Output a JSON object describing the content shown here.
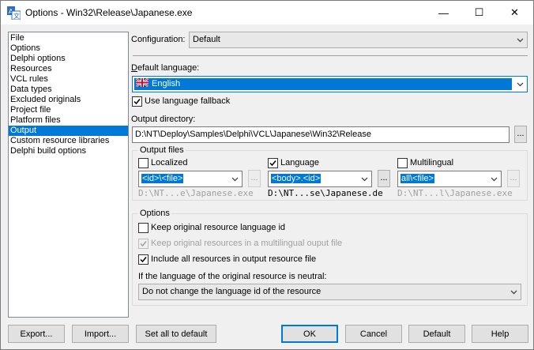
{
  "window": {
    "title": "Options - Win32\\Release\\Japanese.exe",
    "minimize_glyph": "—",
    "maximize_glyph": "☐",
    "close_glyph": "✕",
    "icon": "language-app-icon"
  },
  "tree": {
    "items": [
      {
        "label": "File",
        "selected": false
      },
      {
        "label": "Options",
        "selected": false
      },
      {
        "label": "Delphi options",
        "selected": false
      },
      {
        "label": "Resources",
        "selected": false
      },
      {
        "label": "VCL rules",
        "selected": false
      },
      {
        "label": "Data types",
        "selected": false
      },
      {
        "label": "Excluded originals",
        "selected": false
      },
      {
        "label": "Project file",
        "selected": false
      },
      {
        "label": "Platform files",
        "selected": false
      },
      {
        "label": "Output",
        "selected": true
      },
      {
        "label": "Custom resource libraries",
        "selected": false
      },
      {
        "label": "Delphi build options",
        "selected": false
      }
    ]
  },
  "configuration": {
    "label": "Configuration:",
    "value": "Default"
  },
  "default_language": {
    "label": "Default language:",
    "value": "English",
    "flag_icon": "uk-flag-icon"
  },
  "use_fallback": {
    "label": "Use language fallback",
    "checked": true
  },
  "output_directory": {
    "label": "Output directory:",
    "value": "D:\\NT\\Deploy\\Samples\\Delphi\\VCL\\Japanese\\Win32\\Release",
    "browse_label": "..."
  },
  "output_files": {
    "title": "Output files",
    "localized": {
      "label": "Localized",
      "checked": false,
      "pattern": "<id>\\<file>",
      "preview": "D:\\NT...e\\Japanese.exe",
      "browse_label": "..."
    },
    "language": {
      "label": "Language",
      "checked": true,
      "pattern": "<body>.<id>",
      "preview": "D:\\NT...se\\Japanese.de",
      "browse_label": "..."
    },
    "multilingual": {
      "label": "Multilingual",
      "checked": false,
      "pattern": "all\\<file>",
      "preview": "D:\\NT...l\\Japanese.exe",
      "browse_label": "..."
    }
  },
  "options": {
    "title": "Options",
    "keep_language_id": {
      "label": "Keep original resource language id",
      "checked": false
    },
    "keep_multilingual": {
      "label": "Keep original resources in a multilingual ouput file",
      "checked": true,
      "disabled": true
    },
    "include_all": {
      "label": "Include all resources in output resource file",
      "checked": true
    },
    "neutral_label": "If the language of the original resource is neutral:",
    "neutral_value": "Do not change the language id of the resource"
  },
  "buttons": {
    "export": "Export...",
    "import": "Import...",
    "set_all_default": "Set all to default",
    "ok": "OK",
    "cancel": "Cancel",
    "default": "Default",
    "help": "Help"
  },
  "colors": {
    "accent": "#0078d7",
    "face": "#f0f0f0"
  }
}
